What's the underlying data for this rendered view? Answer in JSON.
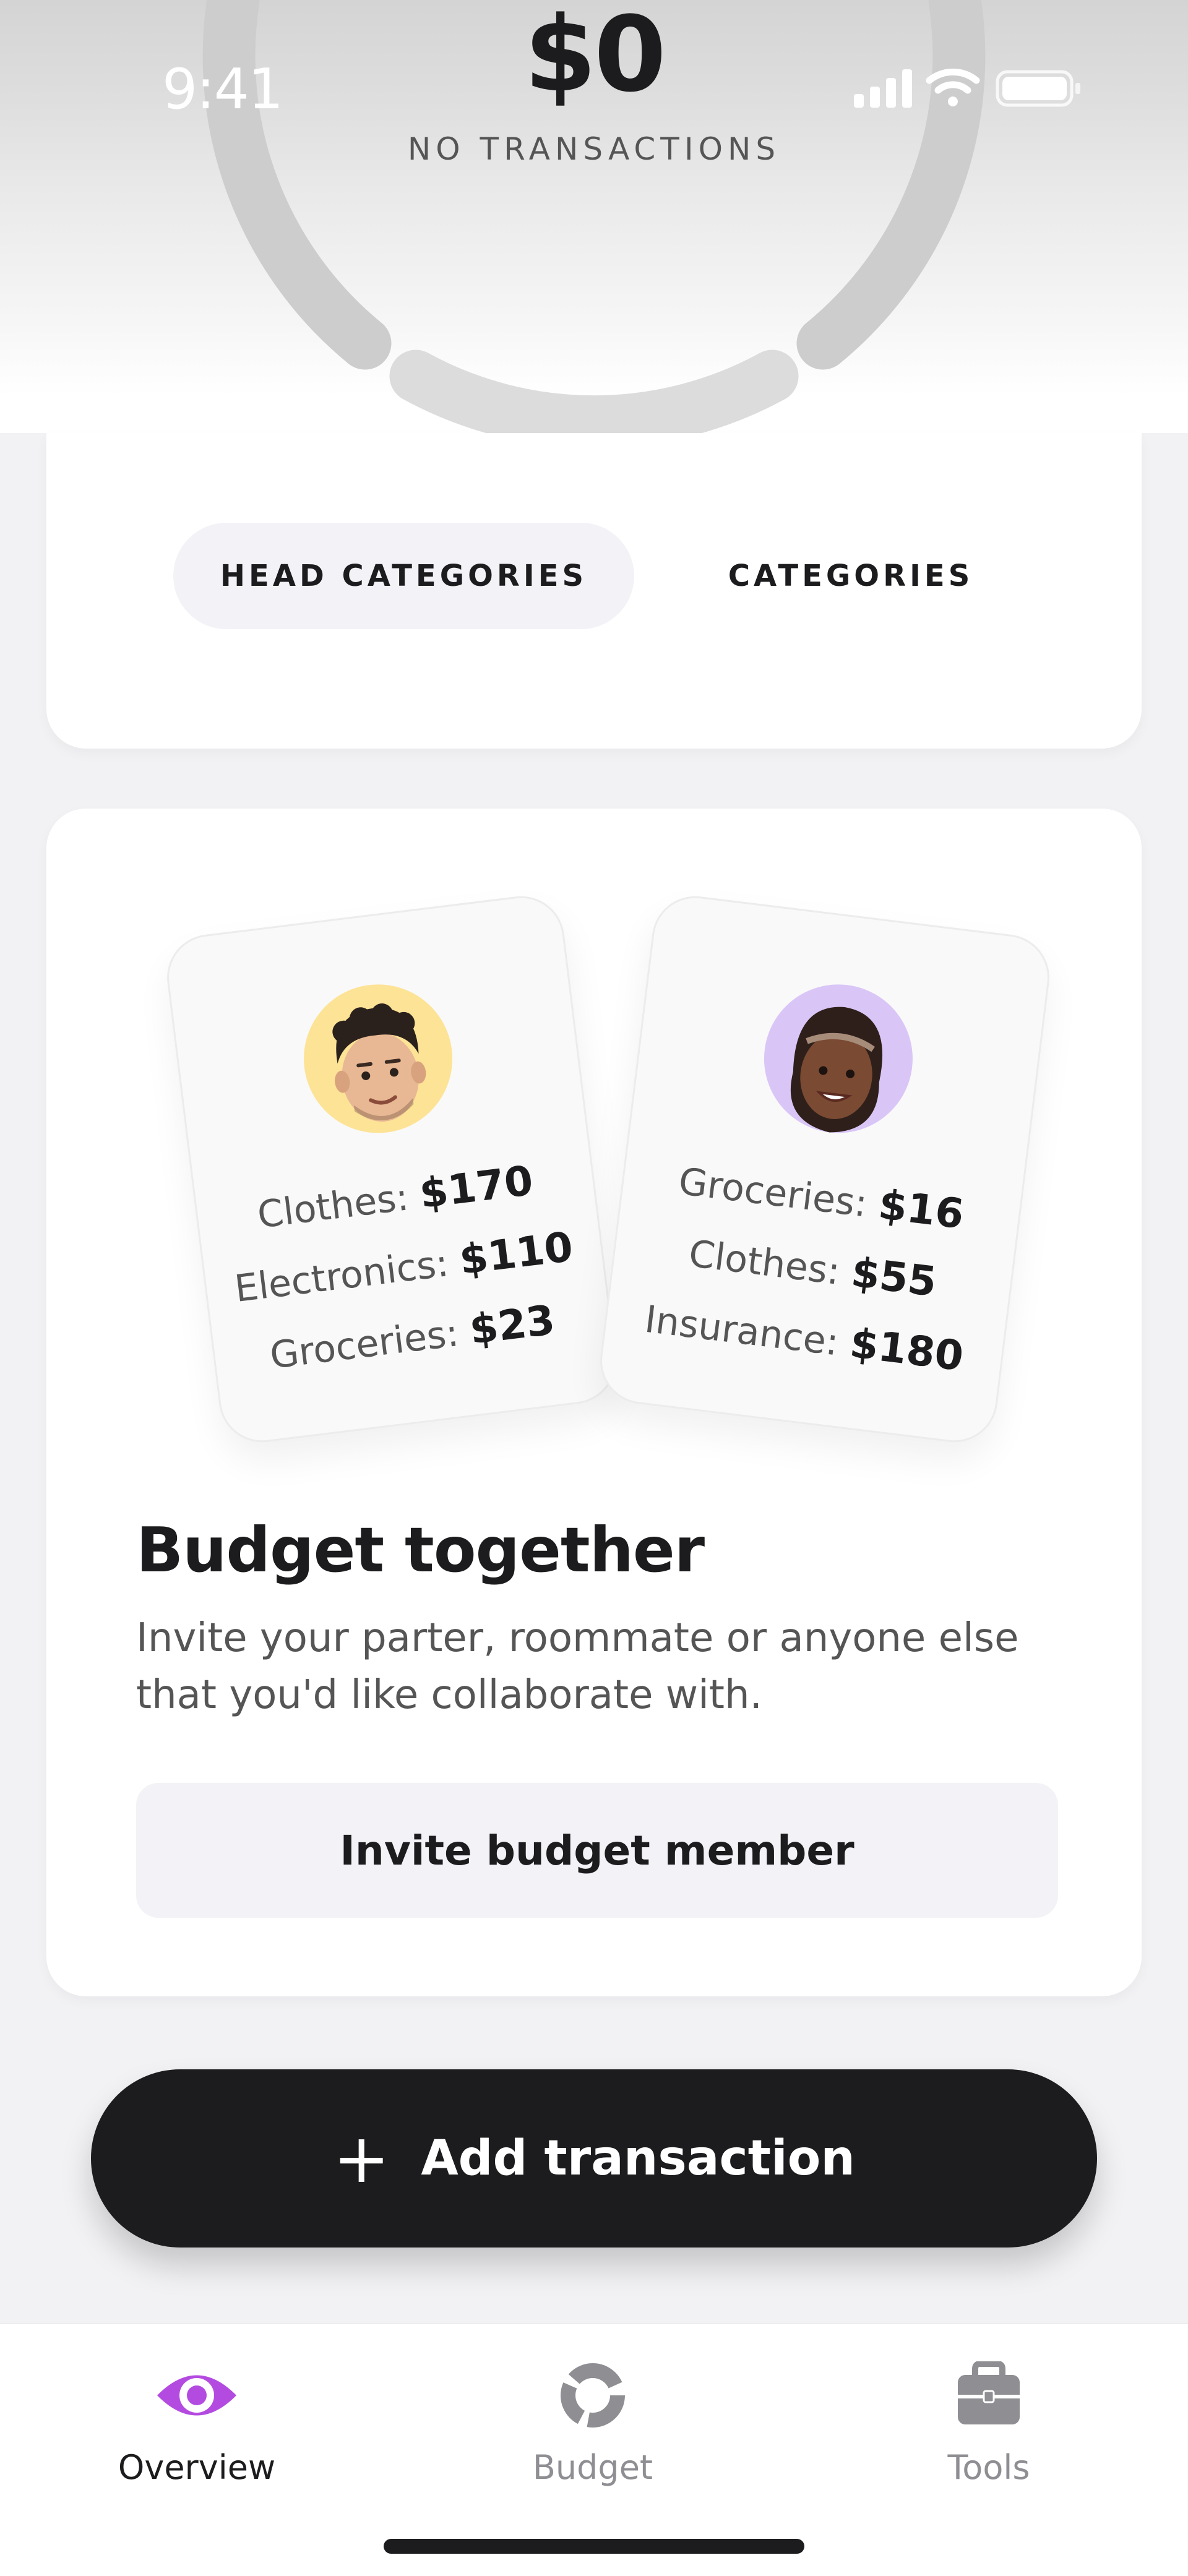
{
  "status_bar": {
    "time": "9:41"
  },
  "summary": {
    "amount": "$0",
    "subtitle": "NO TRANSACTIONS"
  },
  "segments": {
    "head_categories": "HEAD CATEGORIES",
    "categories": "CATEGORIES"
  },
  "budget_together": {
    "left_card": {
      "rows": [
        {
          "label": "Clothes:",
          "value": "$170"
        },
        {
          "label": "Electronics:",
          "value": "$110"
        },
        {
          "label": "Groceries:",
          "value": "$23"
        }
      ]
    },
    "right_card": {
      "rows": [
        {
          "label": "Groceries:",
          "value": "$16"
        },
        {
          "label": "Clothes:",
          "value": "$55"
        },
        {
          "label": "Insurance:",
          "value": "$180"
        }
      ]
    },
    "title": "Budget together",
    "description": "Invite your parter, roommate or anyone else that you'd like collaborate with.",
    "invite_button": "Invite budget member"
  },
  "add_transaction": {
    "plus": "+",
    "label": "Add transaction"
  },
  "tabbar": {
    "items": [
      {
        "label": "Overview",
        "icon": "eye-icon"
      },
      {
        "label": "Budget",
        "icon": "donut-chart-icon"
      },
      {
        "label": "Tools",
        "icon": "toolbox-icon"
      }
    ]
  },
  "colors": {
    "accent": "#b44be1",
    "dark": "#1c1c1e",
    "muted": "#8e8e93"
  }
}
